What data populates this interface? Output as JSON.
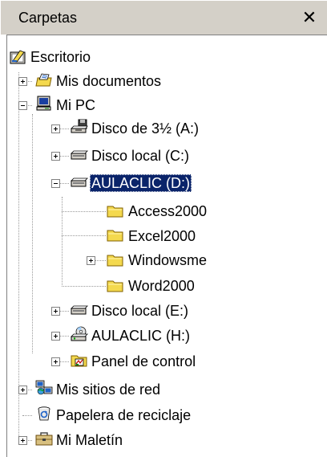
{
  "panel": {
    "title": "Carpetas",
    "close_glyph": "✕"
  },
  "colors": {
    "selection_bg": "#0a246a",
    "selection_fg": "#ffffff",
    "panel_bg": "#d4d0c8",
    "folder_yellow": "#f4d94e"
  },
  "tree": {
    "escritorio": {
      "label": "Escritorio",
      "icon": "desktop-icon"
    },
    "mis_documentos": {
      "label": "Mis documentos",
      "icon": "my-documents-icon",
      "expander": "+"
    },
    "mi_pc": {
      "label": "Mi PC",
      "icon": "my-computer-icon",
      "expander": "-"
    },
    "disco_a": {
      "label": "Disco de 3½ (A:)",
      "icon": "floppy-drive-icon",
      "expander": "+"
    },
    "disco_c": {
      "label": "Disco local (C:)",
      "icon": "hard-drive-icon",
      "expander": "+"
    },
    "aulaclic_d": {
      "label": "AULACLIC (D:)",
      "icon": "hard-drive-icon",
      "expander": "-",
      "selected": true
    },
    "access2000": {
      "label": "Access2000",
      "icon": "folder-icon"
    },
    "excel2000": {
      "label": "Excel2000",
      "icon": "folder-icon"
    },
    "windowsme": {
      "label": "Windowsme",
      "icon": "folder-icon",
      "expander": "+"
    },
    "word2000": {
      "label": "Word2000",
      "icon": "folder-icon"
    },
    "disco_e": {
      "label": "Disco local (E:)",
      "icon": "hard-drive-icon",
      "expander": "+"
    },
    "aulaclic_h": {
      "label": "AULACLIC (H:)",
      "icon": "cd-drive-icon",
      "expander": "+"
    },
    "panel_control": {
      "label": "Panel de control",
      "icon": "control-panel-icon",
      "expander": "+"
    },
    "mis_sitios_red": {
      "label": "Mis sitios de red",
      "icon": "network-places-icon",
      "expander": "+"
    },
    "papelera": {
      "label": "Papelera de reciclaje",
      "icon": "recycle-bin-icon"
    },
    "mi_maletin": {
      "label": "Mi Maletín",
      "icon": "briefcase-icon",
      "expander": "+"
    }
  }
}
